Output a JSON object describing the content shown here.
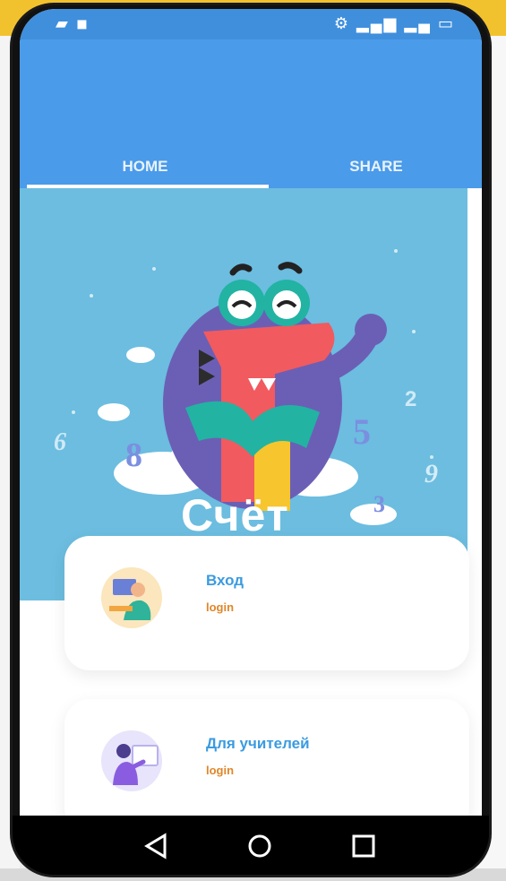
{
  "status_bar": {
    "left_icons": "▰ ◾",
    "right_icons": "⚙ ▂▄▆ ▂▄ ▭"
  },
  "tabs": [
    {
      "label": "HOME",
      "selected": true
    },
    {
      "label": "SHARE",
      "selected": false
    }
  ],
  "hero": {
    "title": "Счёт",
    "digits": [
      "6",
      "8",
      "5",
      "2",
      "9",
      "3"
    ]
  },
  "cards": [
    {
      "title": "Вход",
      "subtitle": "login",
      "icon": "student-at-computer-icon"
    },
    {
      "title": "Для учителей",
      "subtitle": "login",
      "icon": "teacher-at-board-icon"
    }
  ],
  "nav": {
    "back_icon": "back-icon",
    "home_icon": "home-icon",
    "recents_icon": "recents-icon"
  },
  "colors": {
    "app_bar": "#4a9bea",
    "hero_bg": "#6cbde0",
    "card_title": "#3b9be0",
    "card_sub": "#e0862a"
  }
}
